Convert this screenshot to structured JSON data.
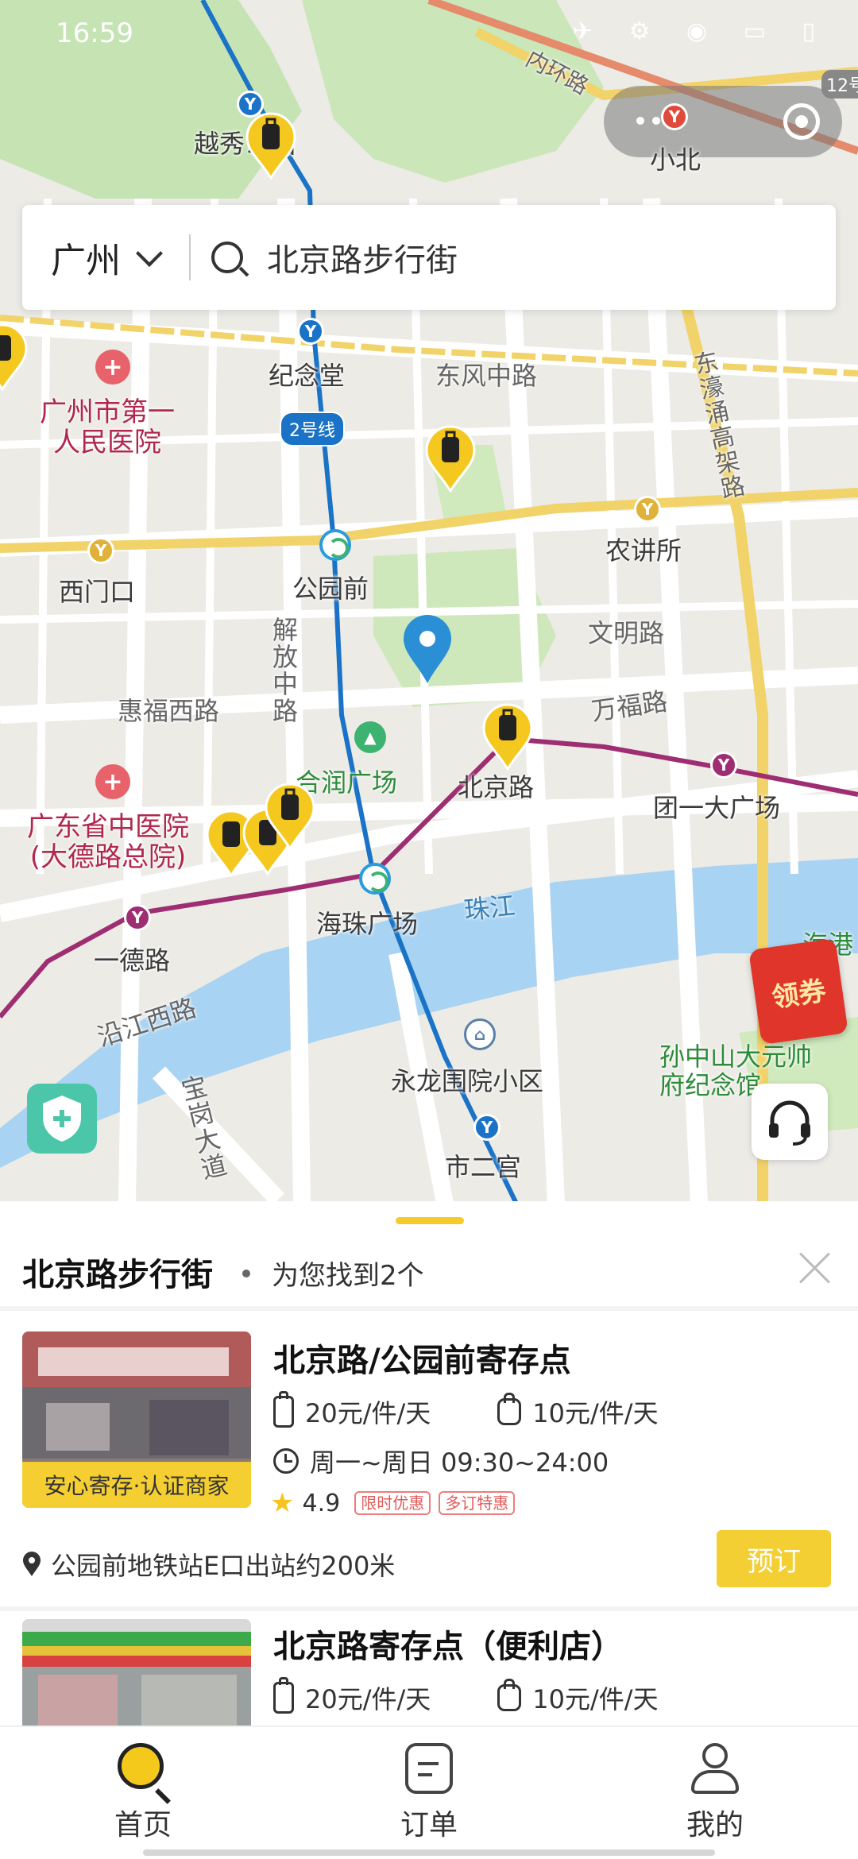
{
  "status_bar": {
    "time": "16:59",
    "icons": "✈ ⚙ ◉ ▭ ▯"
  },
  "search": {
    "city": "广州",
    "query": "北京路步行街"
  },
  "map": {
    "labels": {
      "yuexiu": "越秀公园",
      "xiaobei": "小北",
      "neihuanlu": "内环路",
      "jiniantang": "纪念堂",
      "dongfeng": "东风中路",
      "hosp1": "广州市第一\n人民医院",
      "line2": "2号线",
      "dhyb": "东濠涌高架路",
      "nongjiangsuo": "农讲所",
      "ximenkou": "西门口",
      "gongyuanqian": "公园前",
      "wenming": "文明路",
      "jiefang": "解放中路",
      "huifu": "惠福西路",
      "wanfu": "万福路",
      "herun": "合润广场",
      "beijinglu": "北京路",
      "tuanyi": "团一大广场",
      "hosp2": "广东省中医院\n(大德路总院)",
      "haizhu": "海珠广场",
      "zhujiang": "珠江",
      "yide": "一德路",
      "yanjiang": "沿江西路",
      "yonglong": "永龙围院小区",
      "sunzhongshan": "孙中山大元帅\n府纪念馆",
      "baogang": "宝岗大道",
      "shiergong": "市二宫",
      "haigang": "海港",
      "linelabel12": "12号"
    }
  },
  "coupon": {
    "label": "领券"
  },
  "sheet": {
    "title": "北京路步行街",
    "count": "为您找到2个",
    "stores": [
      {
        "name": "北京路/公园前寄存点",
        "badge": "安心寄存·认证商家",
        "price_large": "20元/件/天",
        "price_small": "10元/件/天",
        "hours": "周一~周日 09:30~24:00",
        "rating": "4.9",
        "tags": [
          "限时优惠",
          "多订特惠"
        ],
        "address": "公园前地铁站E口出站约200米",
        "book": "预订"
      },
      {
        "name": "北京路寄存点（便利店）",
        "price_large": "20元/件/天",
        "price_small": "10元/件/天"
      }
    ]
  },
  "tabbar": {
    "home": "首页",
    "orders": "订单",
    "me": "我的"
  }
}
